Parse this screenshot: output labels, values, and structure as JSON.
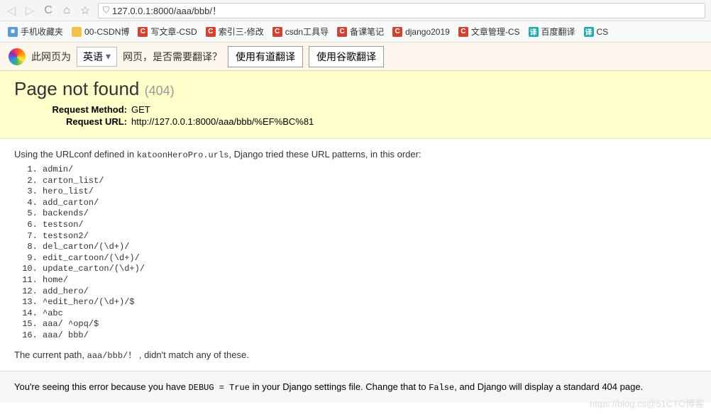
{
  "browser": {
    "url": "127.0.0.1:8000/aaa/bbb/！"
  },
  "bookmarks": [
    {
      "icon": "bm-blue",
      "label": "手机收藏夹"
    },
    {
      "icon": "bm-folder",
      "label": "00-CSDN博"
    },
    {
      "icon": "bm-red",
      "label": "写文章-CSD"
    },
    {
      "icon": "bm-red",
      "label": "索引三-修改"
    },
    {
      "icon": "bm-red",
      "label": "csdn工具导"
    },
    {
      "icon": "bm-red",
      "label": "备课笔记"
    },
    {
      "icon": "bm-red",
      "label": "django2019"
    },
    {
      "icon": "bm-red",
      "label": "文章管理-CS"
    },
    {
      "icon": "bm-teal",
      "label": "百度翻译"
    },
    {
      "icon": "bm-teal",
      "label": "CS"
    }
  ],
  "translate": {
    "prefix": "此网页为",
    "lang": "英语",
    "suffix": "网页，是否需要翻译？",
    "btn1": "使用有道翻译",
    "btn2": "使用谷歌翻译"
  },
  "error": {
    "title": "Page not found",
    "code": "(404)",
    "method_label": "Request Method:",
    "method_value": "GET",
    "url_label": "Request URL:",
    "url_value": "http://127.0.0.1:8000/aaa/bbb/%EF%BC%81",
    "intro_prefix": "Using the URLconf defined in ",
    "urlconf": "katoonHeroPro.urls",
    "intro_suffix": ", Django tried these URL patterns, in this order:",
    "patterns": [
      "admin/",
      "carton_list/",
      "hero_list/",
      "add_carton/",
      "backends/",
      "testson/",
      "testson2/",
      "del_carton/(\\d+)/",
      "edit_cartoon/(\\d+)/",
      "update_carton/(\\d+)/",
      "home/",
      "add_hero/",
      "^edit_hero/(\\d+)/$",
      "^abc",
      "aaa/ ^opq/$",
      "aaa/ bbb/"
    ],
    "nomatch_prefix": "The current path, ",
    "nomatch_path": "aaa/bbb/！",
    "nomatch_suffix": " , didn't match any of these.",
    "debug_prefix": "You're seeing this error because you have ",
    "debug_code1": "DEBUG = True",
    "debug_mid": " in your Django settings file. Change that to ",
    "debug_code2": "False",
    "debug_suffix": ", and Django will display a standard 404 page."
  },
  "watermark": "https://blog.cs@51CTO博客"
}
